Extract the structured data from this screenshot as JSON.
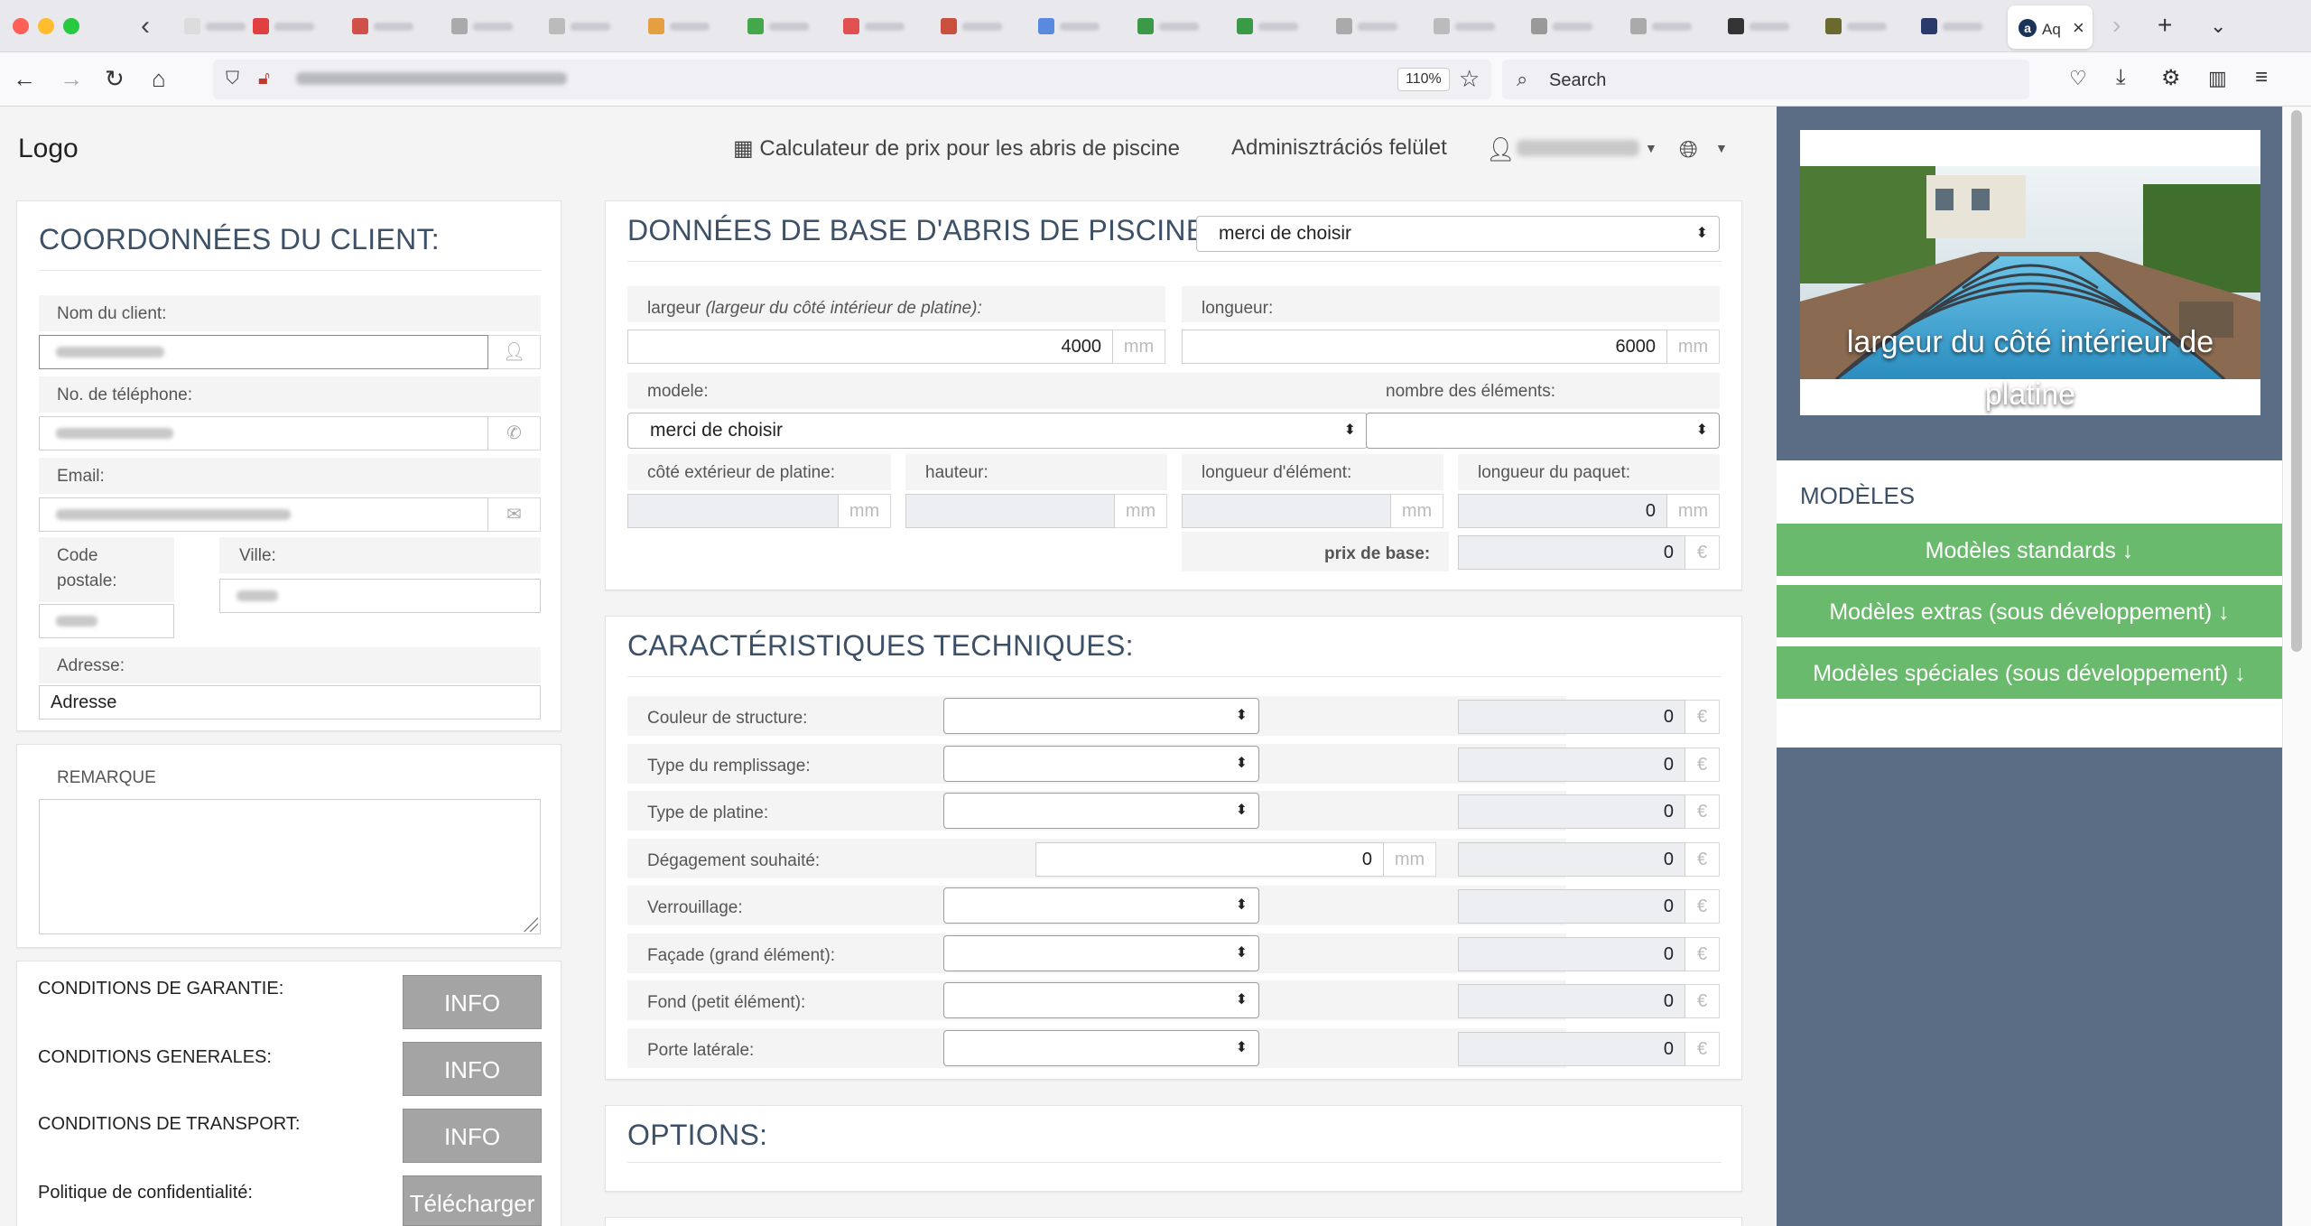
{
  "browser": {
    "active_tab_title": "Aq",
    "zoom": "110%",
    "search_placeholder": "Search"
  },
  "header": {
    "logo": "Logo",
    "calc_link": "Calculateur de prix pour les abris de piscine",
    "admin_link": "Adminisztrációs felület"
  },
  "client": {
    "title": "COORDONNÉES DU CLIENT:",
    "name_label": "Nom du client:",
    "phone_label": "No. de téléphone:",
    "email_label": "Email:",
    "zip_label_1": "Code",
    "zip_label_2": "postale:",
    "city_label": "Ville:",
    "address_label": "Adresse:",
    "address_placeholder": "Adresse"
  },
  "remark": {
    "label": "REMARQUE"
  },
  "conditions": {
    "warranty": "CONDITIONS DE GARANTIE:",
    "general": "CONDITIONS GENERALES:",
    "transport": "CONDITIONS DE TRANSPORT:",
    "privacy": "Politique de confidentialité:",
    "info_btn": "INFO",
    "download_btn": "Télécharger"
  },
  "base": {
    "title": "DONNÉES DE BASE D'ABRIS DE PISCINE:",
    "select_default": "merci de choisir",
    "width_label": "largeur",
    "width_hint": "(largeur du côté intérieur de platine):",
    "width_value": "4000",
    "length_label": "longueur:",
    "length_value": "6000",
    "unit_mm": "mm",
    "unit_eur": "€",
    "model_label": "modele:",
    "elements_label": "nombre des éléments:",
    "outer_label": "côté extérieur de platine:",
    "height_label": "hauteur:",
    "elem_length_label": "longueur d'élément:",
    "package_length_label": "longueur du paquet:",
    "package_length_value": "0",
    "base_price_label": "prix de base:",
    "base_price_value": "0"
  },
  "tech": {
    "title": "CARACTÉRISTIQUES TECHNIQUES:",
    "rows": [
      {
        "label": "Couleur de structure:",
        "value": "0"
      },
      {
        "label": "Type du remplissage:",
        "value": "0"
      },
      {
        "label": "Type de platine:",
        "value": "0"
      },
      {
        "label": "Dégagement souhaité:",
        "value": "0",
        "input": "0"
      },
      {
        "label": "Verrouillage:",
        "value": "0"
      },
      {
        "label": "Façade (grand élément):",
        "value": "0"
      },
      {
        "label": "Fond (petit élément):",
        "value": "0"
      },
      {
        "label": "Porte latérale:",
        "value": "0"
      }
    ]
  },
  "options": {
    "title": "OPTIONS:"
  },
  "sidebar": {
    "image_caption": "largeur du côté intérieur de platine",
    "models_title": "MODÈLES",
    "btn_standard": "Modèles standards ↓",
    "btn_extra": "Modèles extras (sous développement) ↓",
    "btn_special": "Modèles spéciales (sous développement) ↓"
  },
  "colors": {
    "sidebar": "#5b6c85",
    "green": "#6aba6e",
    "title": "#3c5068",
    "info_btn": "#a4a4a4"
  }
}
